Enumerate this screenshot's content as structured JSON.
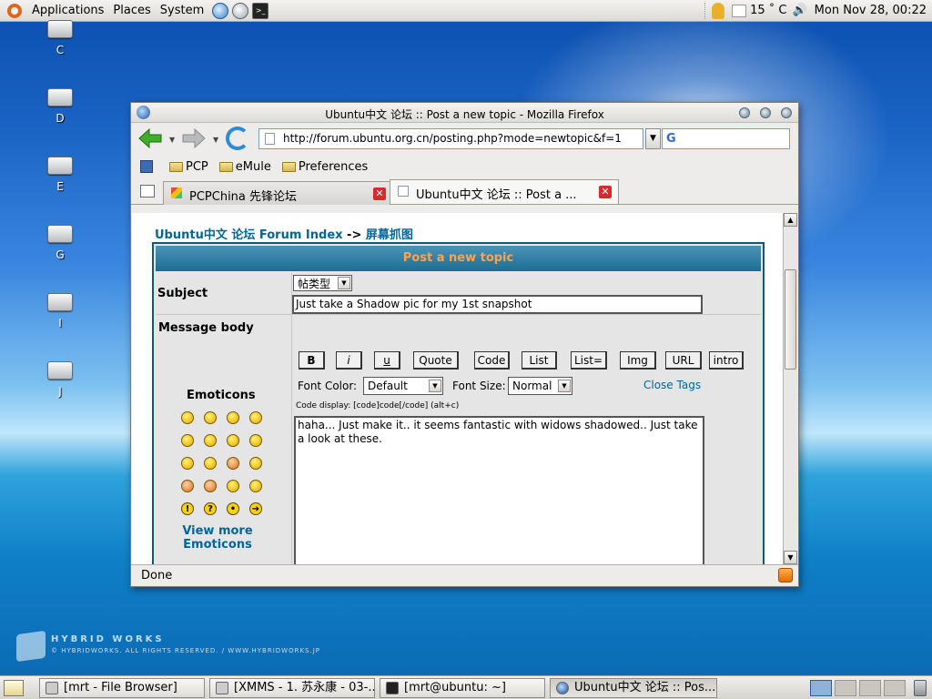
{
  "top_panel": {
    "menus": [
      "Applications",
      "Places",
      "System"
    ],
    "temperature": "15 ˚ C",
    "clock": "Mon Nov 28, 00:22"
  },
  "desktop_icons": [
    "C",
    "D",
    "E",
    "G",
    "I",
    "J"
  ],
  "watermark": {
    "title": "HYBRID WORKS",
    "subtitle": "© HYBRIDWORKS. ALL RIGHTS RESERVED. / WWW.HYBRIDWORKS.JP"
  },
  "window": {
    "title": "Ubuntu中文 论坛 :: Post a new topic - Mozilla Firefox",
    "url": "http://forum.ubuntu.org.cn/posting.php?mode=newtopic&f=1",
    "bookmarks": [
      "PCP",
      "eMule",
      "Preferences"
    ],
    "tabs": [
      {
        "label": "PCPChina 先锋论坛",
        "active": false
      },
      {
        "label": "Ubuntu中文 论坛 :: Post a ...",
        "active": true
      }
    ],
    "status": "Done"
  },
  "page": {
    "breadcrumb_link": "Ubuntu中文 论坛 Forum Index",
    "breadcrumb_sep": "->",
    "breadcrumb_current": "屏幕抓图",
    "form_header": "Post a new topic",
    "subject_label": "Subject",
    "topic_type": "帖类型",
    "subject_value": "Just take a Shadow pic for my 1st snapshot",
    "message_label": "Message body",
    "bbcode_buttons": [
      "B",
      "i",
      "u",
      "Quote",
      "Code",
      "List",
      "List=",
      "Img",
      "URL",
      "intro"
    ],
    "font_color_label": "Font Color:",
    "font_color_value": "Default",
    "font_size_label": "Font Size:",
    "font_size_value": "Normal",
    "close_tags": "Close Tags",
    "code_display": "Code display: [code]code[/code]  (alt+c)",
    "message_text": "haha... Just make it.. it seems fantastic with widows shadowed.. Just take a look at these.",
    "emoticons_title": "Emoticons",
    "view_more": "View more Emoticons"
  },
  "taskbar": {
    "tasks": [
      {
        "label": "[mrt - File Browser]",
        "active": false
      },
      {
        "label": "[XMMS - 1. 苏永康 - 03-...",
        "active": false
      },
      {
        "label": "[mrt@ubuntu: ~]",
        "active": false
      },
      {
        "label": "Ubuntu中文 论坛 :: Pos...",
        "active": true
      }
    ]
  },
  "colors": {
    "link": "#006699",
    "form_header_text": "#ffa34f",
    "form_header_bg": "#1c6d94",
    "close_tab": "#d82a2a"
  }
}
